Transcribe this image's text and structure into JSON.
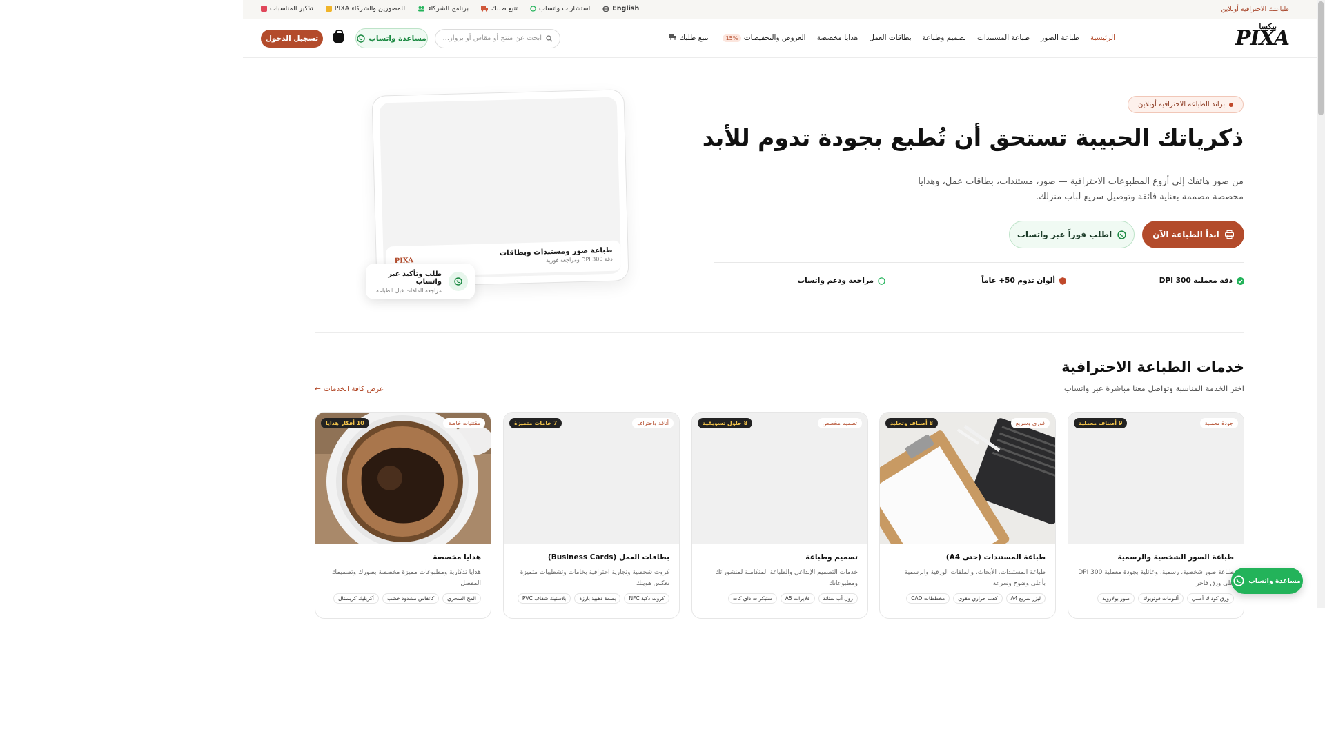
{
  "topbar": {
    "tagline": "طباعتك الاحترافية أونلاين",
    "links": [
      {
        "label": "English",
        "icon": "globe-icon"
      },
      {
        "label": "استشارات واتساب",
        "icon": "whatsapp-icon"
      },
      {
        "label": "تتبع طلبك",
        "icon": "truck-icon"
      },
      {
        "label": "برنامج الشركاء",
        "icon": "users-icon"
      },
      {
        "label": "PIXA للمصورين والشركاء",
        "icon": "camera-icon"
      },
      {
        "label": "تذكير المناسبات",
        "icon": "calendar-icon"
      }
    ]
  },
  "header": {
    "logo_text": "PIXA",
    "logo_arabic": "بيكسا",
    "nav": [
      "الرئيسية",
      "طباعة الصور",
      "طباعة المستندات",
      "تصميم وطباعة",
      "بطاقات العمل",
      "هدايا مخصصة",
      "العروض والتخفيضات",
      "تتبع طلبك"
    ],
    "offers_badge": "15%",
    "search_placeholder": "ابحث عن منتج أو مقاس أو برواز...",
    "whatsapp_help": "مساعدة واتساب",
    "login": "تسجيل الدخول"
  },
  "hero": {
    "badge": "براند الطباعة الاحترافية أونلاين",
    "title": "ذكرياتك الحبيبة تستحق أن تُطبع بجودة تدوم للأبد",
    "subtitle": "من صور هاتفك إلى أروع المطبوعات الاحترافية — صور، مستندات، بطاقات عمل، وهدايا مخصصة مصممة بعناية فائقة وتوصيل سريع لباب منزلك.",
    "primary_cta": "ابدأ الطباعة الآن",
    "secondary_cta": "اطلب فوراً عبر واتساب",
    "features": [
      "دقة معملية 300 DPI",
      "ألوان تدوم 50+ عاماً",
      "مراجعة ودعم واتساب"
    ],
    "mock_title": "طباعة صور ومستندات وبطاقات",
    "mock_sub": "دقة 300 DPI ومراجعة فورية",
    "mock_brand": "PIXA",
    "float_title": "طلب وتأكيد عبر واتساب",
    "float_sub": "مراجعة الملفات قبل الطباعة"
  },
  "services": {
    "title": "خدمات الطباعة الاحترافية",
    "subtitle": "اختر الخدمة المناسبة وتواصل معنا مباشرة عبر واتساب",
    "view_all": "عرض كافة الخدمات",
    "cards": [
      {
        "label": "جودة معملية",
        "count": "9 أصناف معملية",
        "title": "طباعة الصور الشخصية والرسمية",
        "desc": "طباعة صور شخصية، رسمية، وعائلية بجودة معملية 300 DPI على ورق فاخر",
        "tags": [
          "ورق كوداك أصلي",
          "ألبومات فوتوبوك",
          "صور بولارويد"
        ]
      },
      {
        "label": "فوري وسريع",
        "count": "8 أصناف وتجليد",
        "title": "طباعة المستندات (حتى A4)",
        "desc": "طباعة المستندات، الأبحاث، والملفات الورقية والرسمية بأعلى وضوح وسرعة",
        "tags": [
          "ليزر سريع A4",
          "كعب حراري مقوى",
          "مخططات CAD"
        ]
      },
      {
        "label": "تصميم مخصص",
        "count": "8 حلول تسويقية",
        "title": "تصميم وطباعة",
        "desc": "خدمات التصميم الإبداعي والطباعة المتكاملة لمنشوراتك ومطبوعاتك",
        "tags": [
          "رول أب ستاند",
          "فلايرات A5",
          "ستيكرات داي كات"
        ]
      },
      {
        "label": "أناقة واحتراف",
        "count": "7 خامات متميزة",
        "title": "بطاقات العمل (Business Cards)",
        "desc": "كروت شخصية وتجارية احترافية بخامات وتشطيبات متميزة تعكس هويتك",
        "tags": [
          "كروت ذكية NFC",
          "بصمة ذهبية بارزة",
          "بلاستيك شفاف PVC"
        ]
      },
      {
        "label": "مقتنيات خاصة",
        "count": "10 أفكار هدايا",
        "title": "هدايا مخصصة",
        "desc": "هدايا تذكارية ومطبوعات مميزة مخصصة بصورك وتصميمك المفضل",
        "tags": [
          "المج السحري",
          "كانفاس مشدود خشب",
          "أكريليك كريستال"
        ]
      }
    ]
  },
  "fab": {
    "label": "مساعدة واتساب"
  },
  "colors": {
    "brand": "#b34b2b",
    "whatsapp": "#23b35a",
    "dark_pill_text": "#f1c24a"
  }
}
